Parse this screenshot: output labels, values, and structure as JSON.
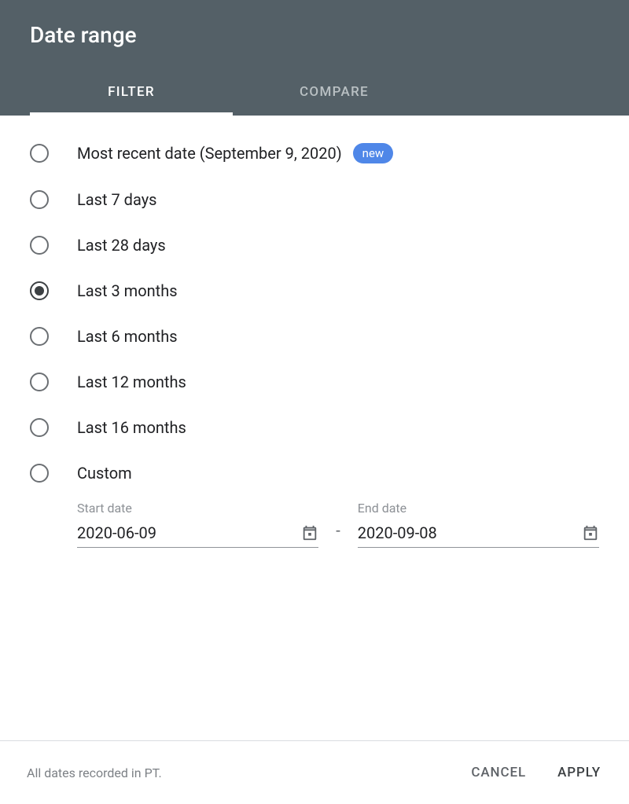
{
  "header": {
    "title": "Date range",
    "tabs": {
      "filter": "FILTER",
      "compare": "COMPARE"
    }
  },
  "options": [
    {
      "label": "Most recent date (September 9, 2020)",
      "badge": "new",
      "selected": false
    },
    {
      "label": "Last 7 days",
      "selected": false
    },
    {
      "label": "Last 28 days",
      "selected": false
    },
    {
      "label": "Last 3 months",
      "selected": true
    },
    {
      "label": "Last 6 months",
      "selected": false
    },
    {
      "label": "Last 12 months",
      "selected": false
    },
    {
      "label": "Last 16 months",
      "selected": false
    },
    {
      "label": "Custom",
      "selected": false
    }
  ],
  "dates": {
    "start_label": "Start date",
    "start_value": "2020-06-09",
    "separator": "-",
    "end_label": "End date",
    "end_value": "2020-09-08"
  },
  "footer": {
    "note": "All dates recorded in PT.",
    "cancel": "CANCEL",
    "apply": "APPLY"
  }
}
